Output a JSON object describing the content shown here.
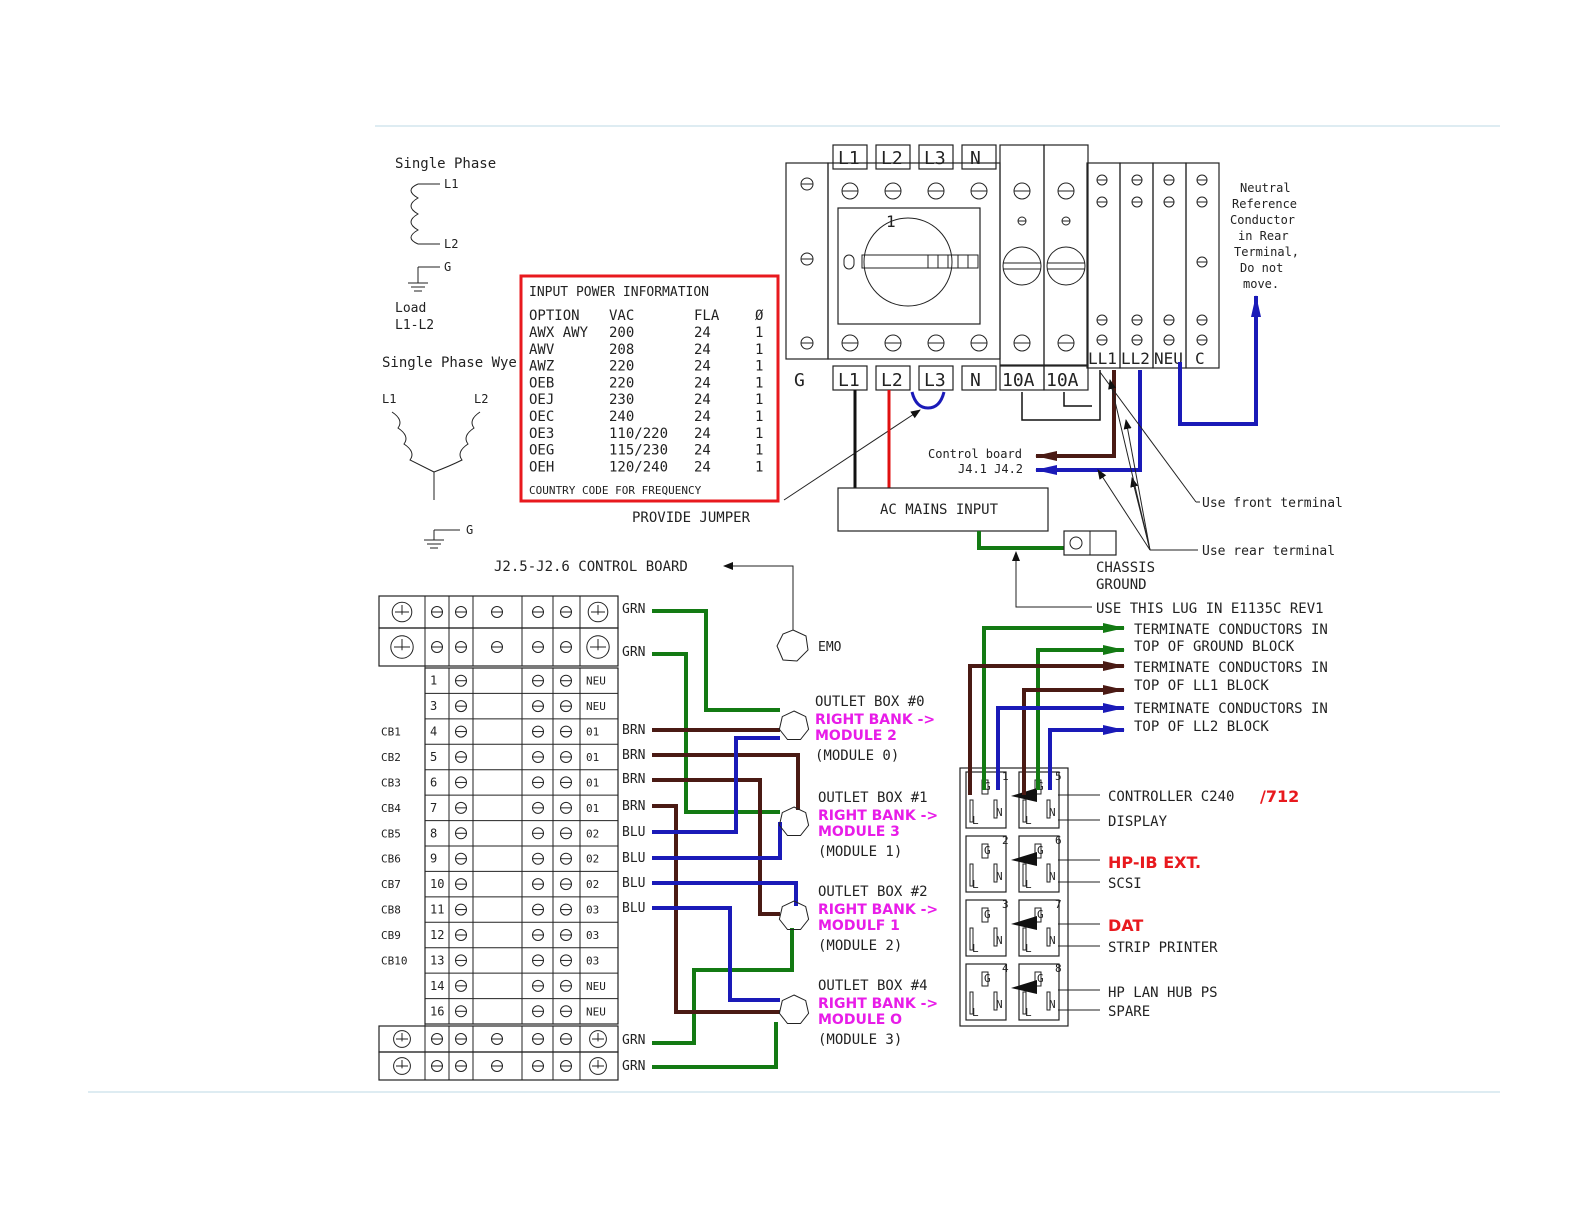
{
  "colors": {
    "ground": "#137a13",
    "ll2": "#1a1ab8",
    "ll1": "#4a1a14",
    "hot": "#e01010",
    "info_box": "#e8191e",
    "module_label": "#e81ce8"
  },
  "wiring": {
    "single_phase": {
      "title": "Single Phase",
      "l1": "L1",
      "l2": "L2",
      "g": "G",
      "load": "Load",
      "load_pair": "L1-L2"
    },
    "single_phase_wye": {
      "title": "Single Phase Wye",
      "l1": "L1",
      "l2": "L2",
      "g": "G"
    }
  },
  "input_power": {
    "title": "INPUT POWER INFORMATION",
    "headers": [
      "OPTION",
      "VAC",
      "FLA",
      "Ø"
    ],
    "rows": [
      [
        "AWX AWY",
        "200",
        "24",
        "1"
      ],
      [
        "AWV",
        "208",
        "24",
        "1"
      ],
      [
        "AWZ",
        "220",
        "24",
        "1"
      ],
      [
        "OEB",
        "220",
        "24",
        "1"
      ],
      [
        "OEJ",
        "230",
        "24",
        "1"
      ],
      [
        "OEC",
        "240",
        "24",
        "1"
      ],
      [
        "OE3",
        "110/220",
        "24",
        "1"
      ],
      [
        "OEG",
        "115/230",
        "24",
        "1"
      ],
      [
        "OEH",
        "120/240",
        "24",
        "1"
      ]
    ],
    "footer": "COUNTRY CODE FOR FREQUENCY"
  },
  "breaker": {
    "top_labels": [
      "L1",
      "L2",
      "L3",
      "N"
    ],
    "bottom_labels": [
      "G",
      "L1",
      "L2",
      "L3",
      "N",
      "10A",
      "10A"
    ],
    "switch_num": "1",
    "terminal_labels": [
      "LL1",
      "LL2",
      "NEU",
      "C"
    ]
  },
  "neutral_note": [
    "Neutral",
    "Reference",
    "Conductor",
    "in Rear",
    "Terminal,",
    "Do not",
    "move."
  ],
  "provide_jumper": "PROVIDE  JUMPER",
  "control_board": {
    "line1": "Control board",
    "line2": "J4.1 J4.2"
  },
  "ac_mains": "AC MAINS INPUT",
  "use_front": "Use front terminal",
  "use_rear": "Use rear terminal",
  "chassis_ground": [
    "CHASSIS",
    "GROUND"
  ],
  "use_lug": "USE THIS LUG IN E1135C REV1",
  "terminate": [
    [
      "TERMINATE CONDUCTORS IN",
      "TOP OF GROUND BLOCK"
    ],
    [
      "TERMINATE CONDUCTORS IN",
      "TOP OF LL1 BLOCK"
    ],
    [
      "TERMINATE CONDUCTORS IN",
      "TOP OF LL2 BLOCK"
    ]
  ],
  "j2_label": "J2.5-J2.6 CONTROL BOARD",
  "emo": "EMO",
  "terminal_block": {
    "row_nums": [
      "1",
      "3",
      "4",
      "5",
      "6",
      "7",
      "8",
      "9",
      "10",
      "11",
      "12",
      "13",
      "14",
      "16"
    ],
    "right_labels": [
      "NEU",
      "NEU",
      "01",
      "01",
      "01",
      "01",
      "02",
      "02",
      "02",
      "03",
      "03",
      "03",
      "NEU",
      "NEU"
    ],
    "cb_labels": [
      "CB1",
      "CB2",
      "CB3",
      "CB4",
      "CB5",
      "CB6",
      "CB7",
      "CB8",
      "CB9",
      "CB10"
    ],
    "wire_labels": [
      "GRN",
      "GRN",
      "BRN",
      "BRN",
      "BRN",
      "BRN",
      "BLU",
      "BLU",
      "BLU",
      "BLU",
      "GRN",
      "GRN"
    ]
  },
  "outlet_boxes": [
    {
      "title": "OUTLET BOX #0",
      "bank": "RIGHT BANK ->",
      "module": "MODULE 2",
      "sub": "(MODULE 0)"
    },
    {
      "title": "OUTLET BOX #1",
      "bank": "RIGHT BANK ->",
      "module": "MODULE 3",
      "sub": "(MODULE 1)"
    },
    {
      "title": "OUTLET BOX #2",
      "bank": "RIGHT BANK ->",
      "module": "MODULF 1",
      "sub": "(MODULE 2)"
    },
    {
      "title": "OUTLET BOX #4",
      "bank": "RIGHT BANK ->",
      "module": "MODULE O",
      "sub": "(MODULE 3)"
    }
  ],
  "receptacle_nums": [
    "1",
    "5",
    "2",
    "6",
    "3",
    "7",
    "4",
    "8"
  ],
  "devices": [
    {
      "black": "CONTROLLER C240",
      "red": "/712"
    },
    {
      "black": "DISPLAY"
    },
    {
      "red": "HP-IB EXT."
    },
    {
      "black": "SCSI"
    },
    {
      "red": "DAT"
    },
    {
      "black": "STRIP PRINTER"
    },
    {
      "black": "HP LAN HUB PS"
    },
    {
      "black": "SPARE"
    }
  ]
}
